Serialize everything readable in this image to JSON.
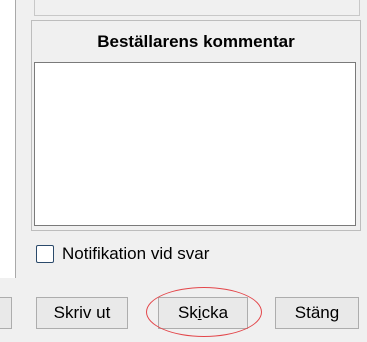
{
  "comments": {
    "header": "Beställarens kommentar",
    "text": ""
  },
  "notification": {
    "label": "Notifikation vid svar",
    "checked": false
  },
  "buttons": {
    "print": "Skriv ut",
    "send": {
      "pre": "Sk",
      "mnemonic": "i",
      "post": "cka"
    },
    "close": {
      "pre": "Stän",
      "mnemonic": "g",
      "post": ""
    }
  },
  "colors": {
    "highlight_circle": "#e3474b",
    "checkbox_border": "#2b4a6b"
  }
}
